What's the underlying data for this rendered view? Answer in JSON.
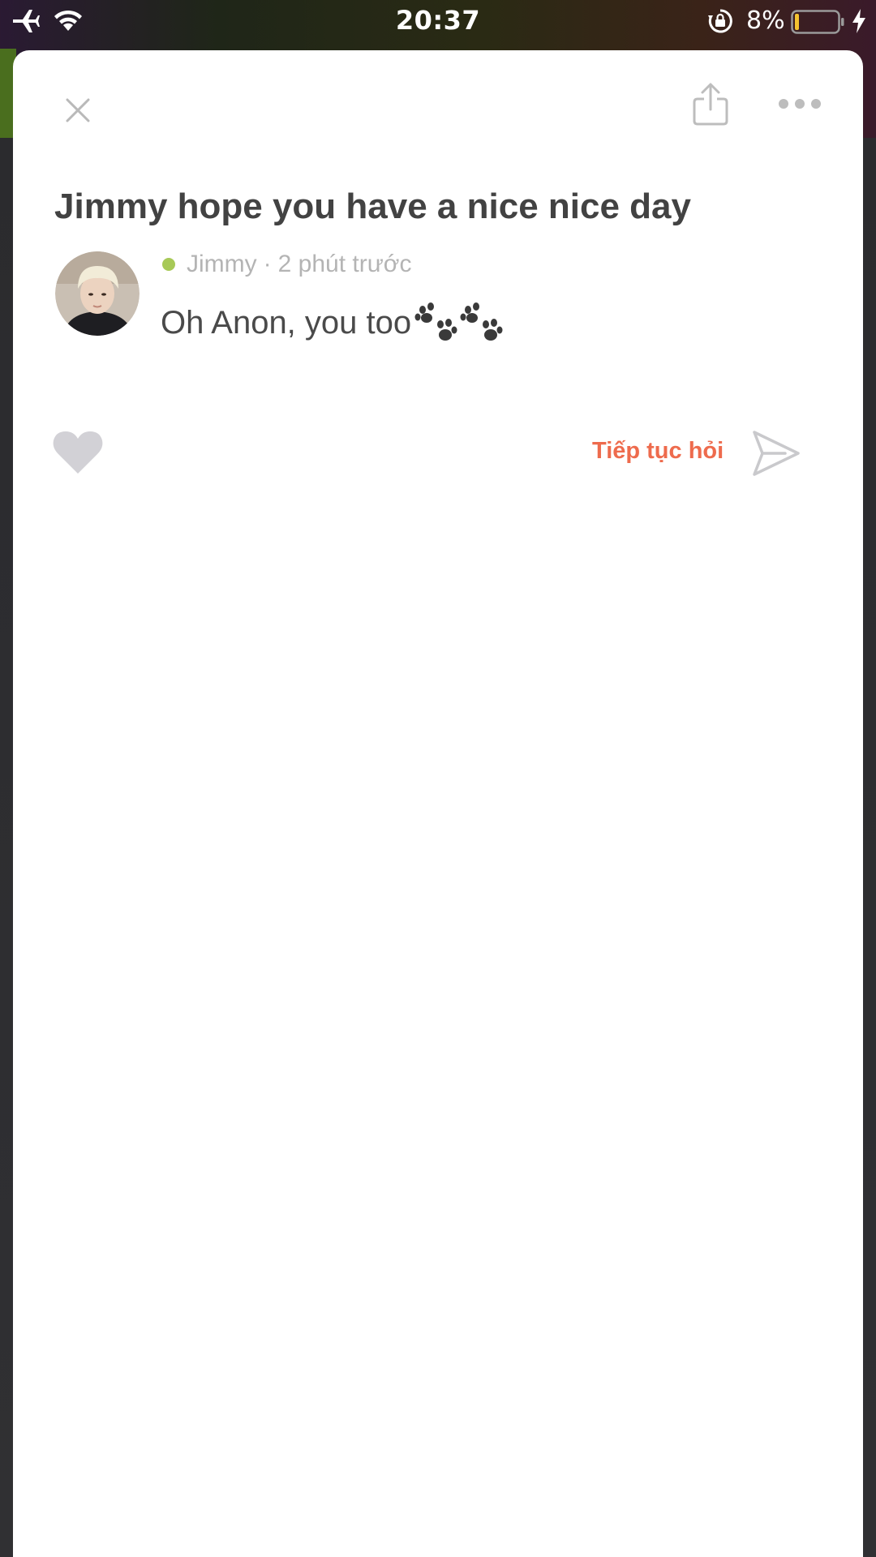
{
  "status_bar": {
    "time": "20:37",
    "battery_percent": "8%",
    "icons": [
      "airplane-icon",
      "wifi-icon",
      "rotation-lock-icon",
      "battery-icon",
      "charging-bolt-icon"
    ]
  },
  "header": {
    "icons": [
      "close-icon",
      "share-icon",
      "more-icon"
    ]
  },
  "question": {
    "title": "Jimmy hope you have a nice nice day"
  },
  "answer": {
    "author": "Jimmy",
    "separator": "·",
    "time_ago": "2 phút trước",
    "text": "Oh Anon, you too",
    "trailing_icons": [
      "paw-icon",
      "paw-icon"
    ],
    "online_color": "#a7c957"
  },
  "actions": {
    "like_icon": "heart-icon",
    "ask_again_label": "Tiếp tục hỏi",
    "send_icon": "send-icon",
    "accent_color": "#ee6b4d"
  }
}
